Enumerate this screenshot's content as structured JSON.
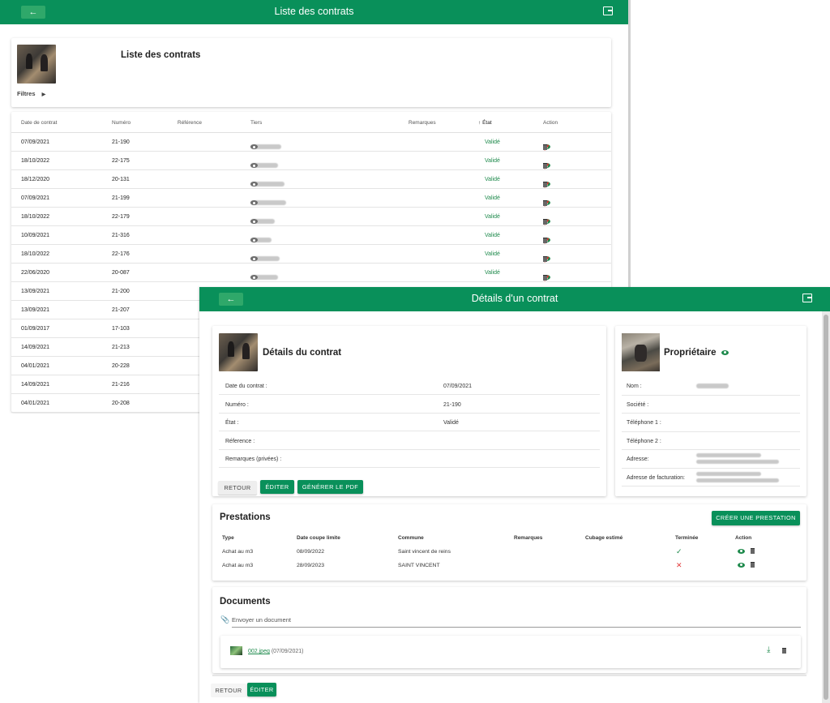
{
  "back_window": {
    "appbar": {
      "title": "Liste des contrats",
      "back_icon": "arrow-left-icon",
      "exit_icon": "logout-icon"
    },
    "header": {
      "title": "Liste des contrats",
      "filters_label": "Filtres",
      "filters_icon": "triangle-right-icon"
    },
    "columns": [
      "Date de contrat",
      "Numéro",
      "Référence",
      "Tiers",
      "Remarques",
      "État",
      "Action"
    ],
    "sort_icon": "arrow-up-icon",
    "rows": [
      {
        "date": "07/09/2021",
        "numero": "21-190",
        "etat": "Validé",
        "has_actions": true
      },
      {
        "date": "18/10/2022",
        "numero": "22-175",
        "etat": "Validé",
        "has_actions": true
      },
      {
        "date": "18/12/2020",
        "numero": "20-131",
        "etat": "Validé",
        "has_actions": true
      },
      {
        "date": "07/09/2021",
        "numero": "21-199",
        "etat": "Validé",
        "has_actions": true
      },
      {
        "date": "18/10/2022",
        "numero": "22-179",
        "etat": "Validé",
        "has_actions": true
      },
      {
        "date": "10/09/2021",
        "numero": "21-316",
        "etat": "Validé",
        "has_actions": true
      },
      {
        "date": "18/10/2022",
        "numero": "22-176",
        "etat": "Validé",
        "has_actions": true
      },
      {
        "date": "22/06/2020",
        "numero": "20-087",
        "etat": "Validé",
        "has_actions": true
      },
      {
        "date": "13/09/2021",
        "numero": "21-200",
        "etat": "",
        "has_actions": false
      },
      {
        "date": "13/09/2021",
        "numero": "21-207",
        "etat": "",
        "has_actions": false
      },
      {
        "date": "01/09/2017",
        "numero": "17-103",
        "etat": "",
        "has_actions": false
      },
      {
        "date": "14/09/2021",
        "numero": "21-213",
        "etat": "",
        "has_actions": false
      },
      {
        "date": "04/01/2021",
        "numero": "20-228",
        "etat": "",
        "has_actions": false
      },
      {
        "date": "14/09/2021",
        "numero": "21-216",
        "etat": "",
        "has_actions": false
      },
      {
        "date": "04/01/2021",
        "numero": "20-208",
        "etat": "",
        "has_actions": false
      }
    ]
  },
  "front_window": {
    "appbar": {
      "title": "Détails d'un contrat",
      "back_icon": "arrow-left-icon",
      "exit_icon": "logout-icon"
    },
    "contract": {
      "title": "Détails du contrat",
      "fields": [
        {
          "label": "Date du contrat :",
          "value": "07/09/2021",
          "green": false
        },
        {
          "label": "Numéro :",
          "value": "21-190",
          "green": false
        },
        {
          "label": "État :",
          "value": "Validé",
          "green": true
        },
        {
          "label": "Réference :",
          "value": "",
          "green": false
        },
        {
          "label": "Remarques (privées) :",
          "value": "",
          "green": false
        }
      ],
      "buttons": {
        "retour": "RETOUR",
        "editer": "ÉDITER",
        "pdf": "GÉNÉRER LE PDF"
      }
    },
    "owner": {
      "title": "Propriétaire",
      "fields": [
        "Nom :",
        "Société :",
        "Téléphone 1 :",
        "Téléphone 2 :",
        "Adresse:",
        "Adresse de facturation:"
      ]
    },
    "prestations": {
      "title": "Prestations",
      "create_button": "CRÉER UNE PRESTATION",
      "columns": [
        "Type",
        "Date coupe limite",
        "Commune",
        "Remarques",
        "Cubage estimé",
        "Terminée",
        "Action"
      ],
      "rows": [
        {
          "type": "Achat au m3",
          "date": "08/09/2022",
          "commune": "Saint vincent de reins",
          "terminee": "check-icon"
        },
        {
          "type": "Achat au m3",
          "date": "28/09/2023",
          "commune": "SAINT VINCENT",
          "terminee": "cross-icon"
        }
      ]
    },
    "documents": {
      "title": "Documents",
      "upload_placeholder": "Envoyer un document",
      "file_name": "002.jpeg",
      "file_date": "(07/09/2021)"
    },
    "footer_buttons": {
      "retour": "RETOUR",
      "editer": "ÉDITER"
    }
  }
}
